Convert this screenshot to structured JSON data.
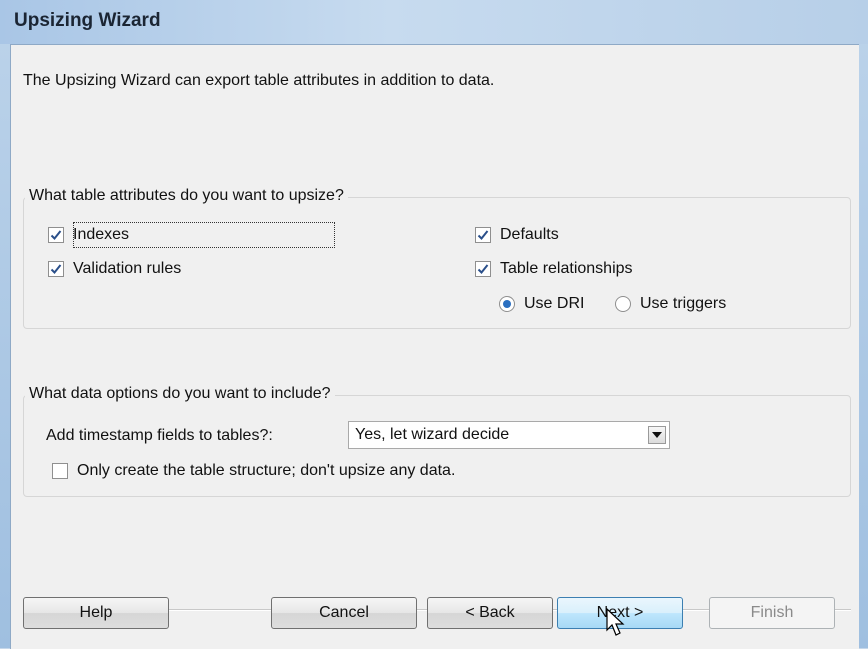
{
  "window": {
    "title": "Upsizing Wizard"
  },
  "intro": "The Upsizing Wizard can export table attributes in addition to data.",
  "attributes": {
    "group_title": "What table attributes do you want to upsize?",
    "indexes": {
      "label": "Indexes",
      "checked": true
    },
    "defaults": {
      "label": "Defaults",
      "checked": true
    },
    "validation": {
      "label": "Validation rules",
      "checked": true
    },
    "relationships": {
      "label": "Table relationships",
      "checked": true
    },
    "use_dri": {
      "label": "Use DRI",
      "selected": true
    },
    "use_triggers": {
      "label": "Use triggers",
      "selected": false
    }
  },
  "data_options": {
    "group_title": "What data options do you want to include?",
    "timestamp_label": "Add timestamp fields to tables?:",
    "timestamp_value": "Yes, let wizard decide",
    "structure_only": {
      "label": "Only create the table structure; don't upsize any data.",
      "checked": false
    }
  },
  "buttons": {
    "help": "Help",
    "cancel": "Cancel",
    "back": "< Back",
    "next": "Next >",
    "finish": "Finish"
  },
  "colors": {
    "accent": "#2a6fc0",
    "default_button": "#a7d9f5",
    "title_bar": "#b7cfe8"
  }
}
